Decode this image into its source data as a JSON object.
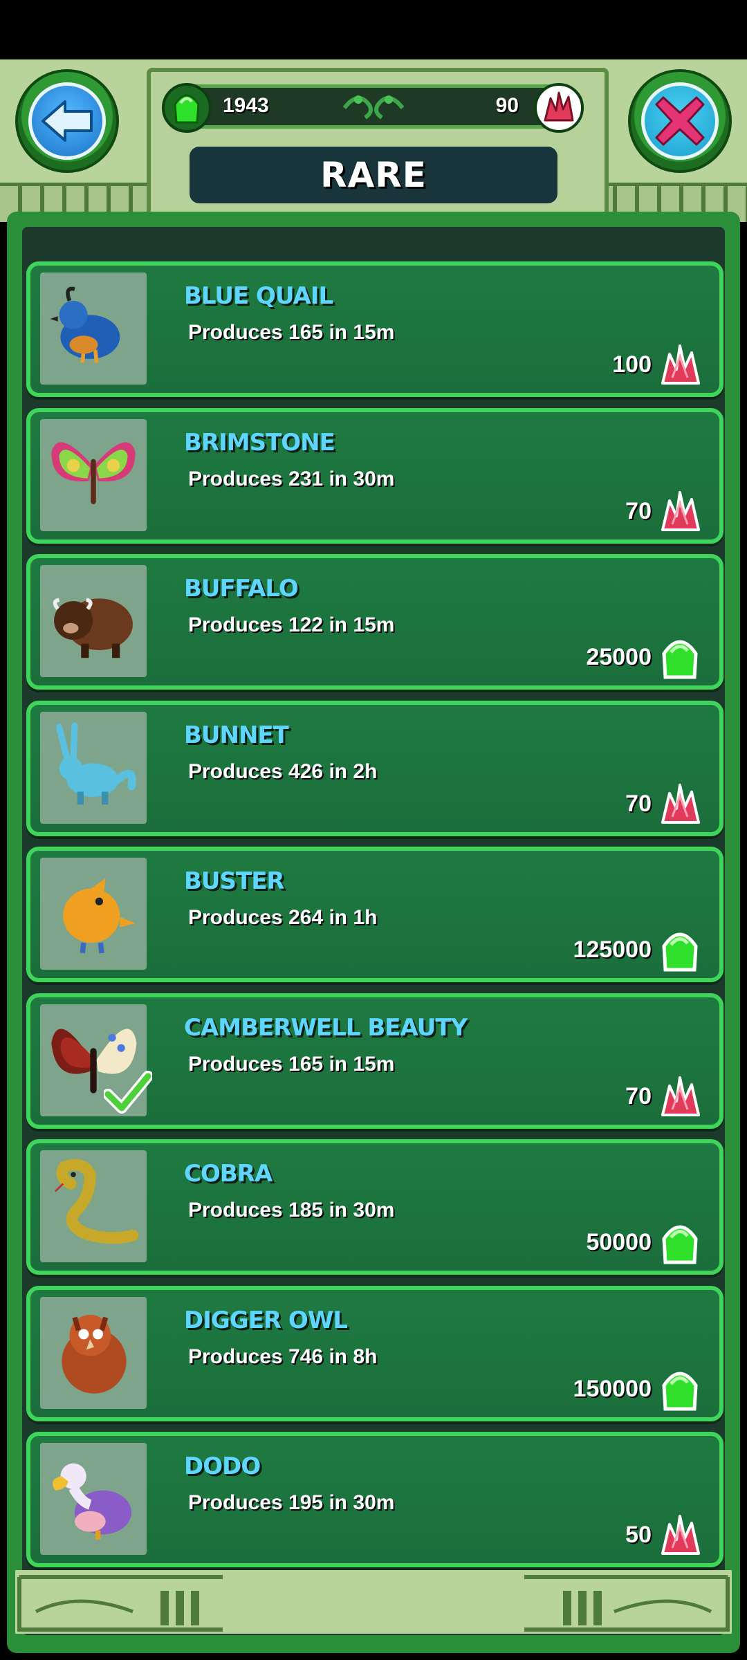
{
  "header": {
    "title": "RARE",
    "gem_count": "1943",
    "crystal_count": "90"
  },
  "icons": {
    "back": "back-arrow-icon",
    "close": "close-x-icon",
    "gem": "green-gem-icon",
    "crystal": "red-crystal-icon"
  },
  "colors": {
    "name_text": "#5fd6ff",
    "card_border": "#3fd45a",
    "gem_green": "#2ee02a",
    "crystal_red": "#e23a5a"
  },
  "items": [
    {
      "name": "BLUE QUAIL",
      "produces": "Produces 165 in 15m",
      "price": "100",
      "currency": "crystal",
      "owned": false
    },
    {
      "name": "BRIMSTONE",
      "produces": "Produces 231 in 30m",
      "price": "70",
      "currency": "crystal",
      "owned": false
    },
    {
      "name": "BUFFALO",
      "produces": "Produces 122 in 15m",
      "price": "25000",
      "currency": "gem",
      "owned": false
    },
    {
      "name": "BUNNET",
      "produces": "Produces 426 in 2h",
      "price": "70",
      "currency": "crystal",
      "owned": false
    },
    {
      "name": "BUSTER",
      "produces": "Produces 264 in 1h",
      "price": "125000",
      "currency": "gem",
      "owned": false
    },
    {
      "name": "CAMBERWELL BEAUTY",
      "produces": "Produces 165 in 15m",
      "price": "70",
      "currency": "crystal",
      "owned": true
    },
    {
      "name": "COBRA",
      "produces": "Produces 185 in 30m",
      "price": "50000",
      "currency": "gem",
      "owned": false
    },
    {
      "name": "DIGGER OWL",
      "produces": "Produces 746 in 8h",
      "price": "150000",
      "currency": "gem",
      "owned": false
    },
    {
      "name": "DODO",
      "produces": "Produces 195 in 30m",
      "price": "50",
      "currency": "crystal",
      "owned": false
    }
  ]
}
